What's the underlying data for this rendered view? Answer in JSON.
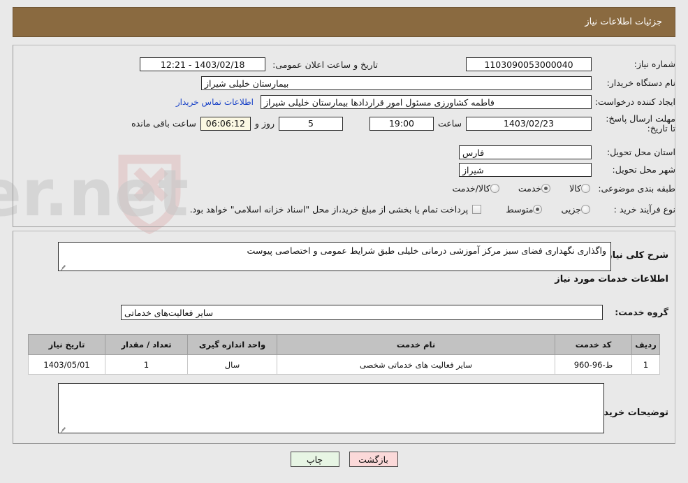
{
  "header": {
    "title": "جزئیات اطلاعات نیاز"
  },
  "form": {
    "need_number_label": "شماره نیاز:",
    "need_number_value": "1103090053000040",
    "announce_datetime_label": "تاریخ و ساعت اعلان عمومی:",
    "announce_datetime_value": "1403/02/18 - 12:21",
    "buyer_org_label": "نام دستگاه خریدار:",
    "buyer_org_value": "بیمارستان خلیلی شیراز",
    "requester_label": "ایجاد کننده درخواست:",
    "requester_value": "فاطمه کشاورزی مسئول امور قراردادها بیمارستان خلیلی شیراز",
    "buyer_contact_link": "اطلاعات تماس خریدار",
    "deadline_label": "مهلت ارسال پاسخ: تا تاریخ:",
    "deadline_date_value": "1403/02/23",
    "time_label": "ساعت",
    "deadline_time_value": "19:00",
    "days_value": "5",
    "days_label": "روز و",
    "countdown_value": "06:06:12",
    "remaining_label": "ساعت باقی مانده",
    "province_label": "استان محل تحویل:",
    "province_value": "فارس",
    "city_label": "شهر محل تحویل:",
    "city_value": "شیراز",
    "category_label": "طبقه بندی موضوعی:",
    "category_options": [
      {
        "label": "کالا",
        "selected": false
      },
      {
        "label": "خدمت",
        "selected": true
      },
      {
        "label": "کالا/خدمت",
        "selected": false
      }
    ],
    "process_label": "نوع فرآیند خرید :",
    "process_options": [
      {
        "label": "جزیی",
        "selected": false
      },
      {
        "label": "متوسط",
        "selected": true
      }
    ],
    "treasury_checkbox_checked": false,
    "treasury_note": "پرداخت تمام یا بخشی از مبلغ خرید،از محل \"اسناد خزانه اسلامی\" خواهد بود."
  },
  "description": {
    "label": "شرح کلی نیاز:",
    "value": "واگذاری نگهداری فضای سبز مرکز آموزشی درمانی خلیلی طبق شرایط عمومی و اختصاصی پیوست"
  },
  "services": {
    "section_title": "اطلاعات خدمات مورد نیاز",
    "group_label": "گروه خدمت:",
    "group_value": "سایر فعالیت‌های خدماتی",
    "columns": [
      "ردیف",
      "کد خدمت",
      "نام خدمت",
      "واحد اندازه گیری",
      "تعداد / مقدار",
      "تاریخ نیاز"
    ],
    "rows": [
      {
        "row": "1",
        "code": "ط-96-960",
        "name": "سایر فعالیت های خدماتی شخصی",
        "unit": "سال",
        "quantity": "1",
        "need_date": "1403/05/01"
      }
    ]
  },
  "buyer_notes": {
    "label": "توضیحات خریدار;",
    "value": ""
  },
  "footer": {
    "print_label": "چاپ",
    "back_label": "بازگشت"
  },
  "watermark": {
    "text": "AriaTender.net"
  },
  "colors": {
    "header_bg": "#8a6a40",
    "page_bg": "#e9e9e9",
    "table_header_bg": "#c2c2c2",
    "link": "#1e46c8",
    "countdown_bg": "#fbf8e3",
    "print_btn_bg": "#e7f5e4",
    "back_btn_bg": "#fbd9d9"
  }
}
